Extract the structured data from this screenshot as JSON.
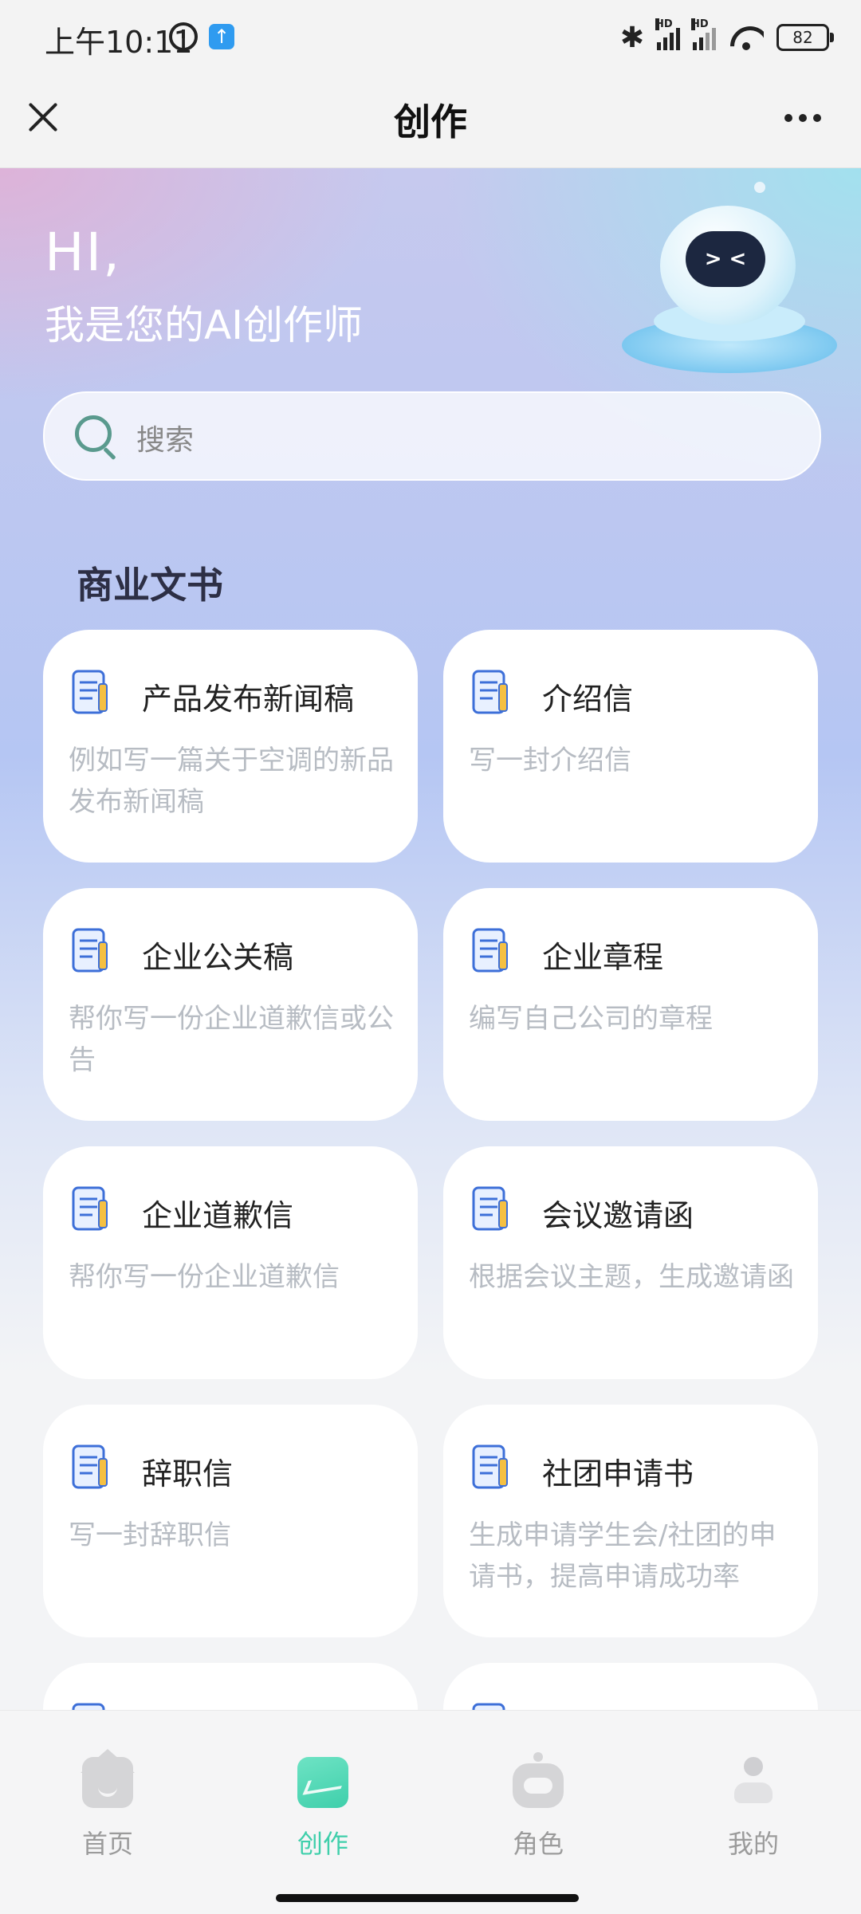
{
  "status_bar": {
    "time": "上午10:11",
    "upload_badge": "↑",
    "bluetooth": "✱",
    "hd1": "HD",
    "hd2": "HD",
    "battery": "82"
  },
  "nav": {
    "title": "创作"
  },
  "hero": {
    "greeting": "HI,",
    "subtitle": "我是您的AI创作师",
    "robot_face": "> <"
  },
  "search": {
    "placeholder": "搜索"
  },
  "section": {
    "title": "商业文书"
  },
  "cards": [
    {
      "title": "产品发布新闻稿",
      "desc": "例如写一篇关于空调的新品发布新闻稿"
    },
    {
      "title": "介绍信",
      "desc": "写一封介绍信"
    },
    {
      "title": "企业公关稿",
      "desc": "帮你写一份企业道歉信或公告"
    },
    {
      "title": "企业章程",
      "desc": "编写自己公司的章程"
    },
    {
      "title": "企业道歉信",
      "desc": "帮你写一份企业道歉信"
    },
    {
      "title": "会议邀请函",
      "desc": "根据会议主题，生成邀请函"
    },
    {
      "title": "辞职信",
      "desc": "写一封辞职信"
    },
    {
      "title": "社团申请书",
      "desc": "生成申请学生会/社团的申请书，提高申请成功率"
    }
  ],
  "tabs": [
    {
      "label": "首页",
      "icon": "home-icon",
      "active": false
    },
    {
      "label": "创作",
      "icon": "create-icon",
      "active": true
    },
    {
      "label": "角色",
      "icon": "robot-icon",
      "active": false
    },
    {
      "label": "我的",
      "icon": "profile-icon",
      "active": false
    }
  ],
  "colors": {
    "accent": "#3fcfab",
    "card_desc": "#b7bcc3",
    "section_title": "#2d2f45"
  }
}
